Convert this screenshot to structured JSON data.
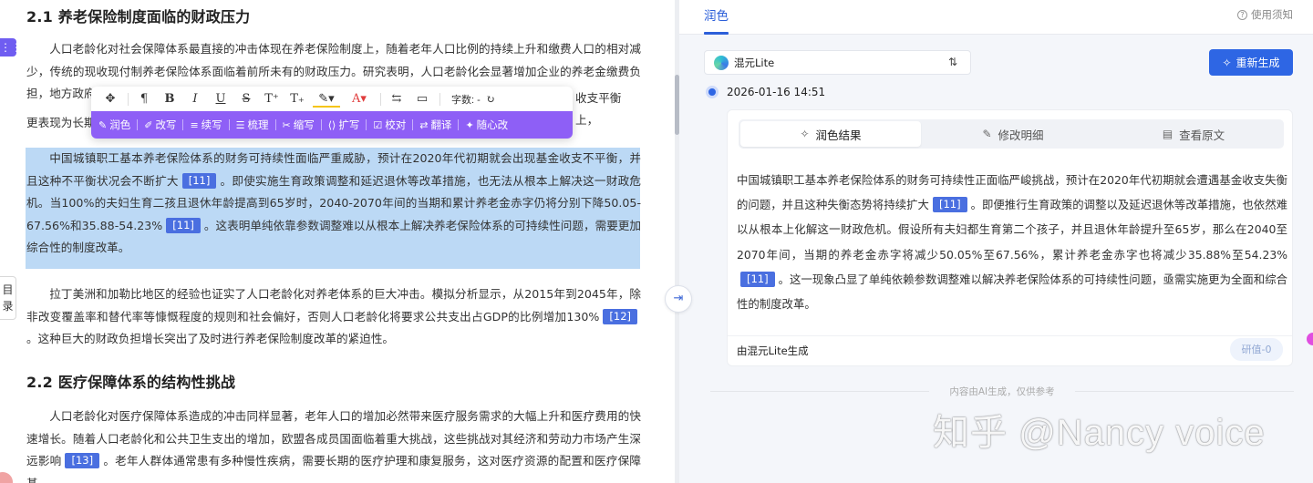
{
  "doc": {
    "h21": "2.1 养老保险制度面临的财政压力",
    "p1": "人口老龄化对社会保障体系最直接的冲击体现在养老保险制度上，随着老年人口比例的持续上升和缴费人口的相对减少，传统的现收现付制养老保险体系面临着前所未有的财政压力。研究表明，人口老龄化会显著增加企业的养老金缴费负担，地方政府",
    "p1_tail_right": "收支平衡上，",
    "p1_line4": "更表现为长期",
    "p2a": "中国城镇职工基本养老保险体系的财务可持续性面临严重威胁，预计在2020年代初期就会出现基金收支不平衡，并且这种不平衡状况会不断扩大",
    "cite11": "[11]",
    "p2b": "。即使实施生育政策调整和延迟退休等改革措施，也无法从根本上解决这一财政危机。当100%的夫妇生育二孩且退休年龄提高到65岁时，2040-2070年间的当期和累计养老金赤字仍将分别下降50.05-67.56%和35.88-54.23%",
    "p2c": "。这表明单纯依靠参数调整难以从根本上解决养老保险体系的可持续性问题，需要更加综合性的制度改革。",
    "p3a": "拉丁美洲和加勒比地区的经验也证实了人口老龄化对养老体系的巨大冲击。模拟分析显示，从2015年到2045年，除非改变覆盖率和替代率等慷慨程度的规则和社会偏好，否则人口老龄化将要求公共支出占GDP的比例增加130%",
    "cite12": "[12]",
    "p3b": "。这种巨大的财政负担增长突出了及时进行养老保险制度改革的紧迫性。",
    "h22": "2.2 医疗保障体系的结构性挑战",
    "p4a": "人口老龄化对医疗保障体系造成的冲击同样显著，老年人口的增加必然带来医疗服务需求的大幅上升和医疗费用的快速增长。随着人口老龄化和公共卫生支出的增加，欧盟各成员国面临着重大挑战，这些挑战对其经济和劳动力市场产生深远影响",
    "cite13": "[13]",
    "p4b": "。老年人群体通常患有多种慢性疾病，需要长期的医疗护理和康复服务，这对医疗资源的配置和医疗保障基",
    "drag_icon": "⋮⋮",
    "toc": "目录"
  },
  "toolbar": {
    "move_icon": "✥",
    "format_icons": [
      "¶",
      "B",
      "I",
      "U",
      "S",
      "T⁺",
      "T₊",
      "A̲",
      "A"
    ],
    "word_count": "字数: -",
    "ai_actions": [
      {
        "icon": "✎",
        "label": "润色"
      },
      {
        "icon": "✐",
        "label": "改写"
      },
      {
        "icon": "≡",
        "label": "续写"
      },
      {
        "icon": "☰",
        "label": "梳理"
      },
      {
        "icon": "✂",
        "label": "缩写"
      },
      {
        "icon": "⟨⟩",
        "label": "扩写"
      },
      {
        "icon": "☑",
        "label": "校对"
      },
      {
        "icon": "⇄",
        "label": "翻译"
      },
      {
        "icon": "✦",
        "label": "随心改"
      }
    ]
  },
  "panel": {
    "tab": "润色",
    "guide": "使用须知",
    "model": "混元Lite",
    "regen": "重新生成",
    "date": "2026-01-16 14:51",
    "tabs": [
      "润色结果",
      "修改明细",
      "查看原文"
    ],
    "result_a": "中国城镇职工基本养老保险体系的财务可持续性正面临严峻挑战，预计在2020年代初期就会遭遇基金收支失衡的问题，并且这种失衡态势将持续扩大",
    "cite11": "[11]",
    "result_b": "。即便推行生育政策的调整以及延迟退休等改革措施，也依然难以从根本上化解这一财政危机。假设所有夫妇都生育第二个孩子，并且退休年龄提升至65岁，那么在2040至2070年间，当期的养老金赤字将减少50.05%至67.56%，累计养老金赤字也将减少35.88%至54.23%",
    "result_c": "。这一现象凸显了单纯依赖参数调整难以解决养老保险体系的可持续性问题，亟需实施更为全面和综合性的制度改革。",
    "gen_label": "由混元Lite生成",
    "eval": "研值-0",
    "disclaimer": "内容由AI生成，仅供参考"
  },
  "watermark": "知乎 @Nancy voice"
}
